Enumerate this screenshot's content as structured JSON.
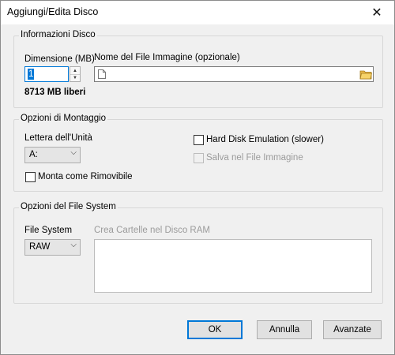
{
  "window": {
    "title": "Aggiungi/Edita Disco",
    "close_glyph": "✕"
  },
  "disk_info": {
    "legend": "Informazioni Disco",
    "size_label": "Dimensione (MB)",
    "size_value": "1",
    "free_space": "8713 MB liberi",
    "image_label": "Nome del File Immagine (opzionale)",
    "image_value": ""
  },
  "mount_options": {
    "legend": "Opzioni di Montaggio",
    "drive_letter_label": "Lettera dell'Unità",
    "drive_letter_value": "A:",
    "removable_label": "Monta come Rimovibile",
    "removable_checked": false,
    "hdd_emulation_label": "Hard Disk Emulation (slower)",
    "hdd_emulation_checked": false,
    "save_in_image_label": "Salva nel File Immagine",
    "save_in_image_checked": false
  },
  "filesystem_options": {
    "legend": "Opzioni del File System",
    "fs_label": "File System",
    "fs_value": "RAW",
    "folders_label": "Crea Cartelle nel Disco RAM",
    "folders_value": ""
  },
  "buttons": {
    "ok": "OK",
    "cancel": "Annulla",
    "advanced": "Avanzate"
  },
  "icons": {
    "close": "close-icon",
    "folder": "folder-icon",
    "file": "file-icon",
    "dropdown": "chevron-down-icon"
  }
}
